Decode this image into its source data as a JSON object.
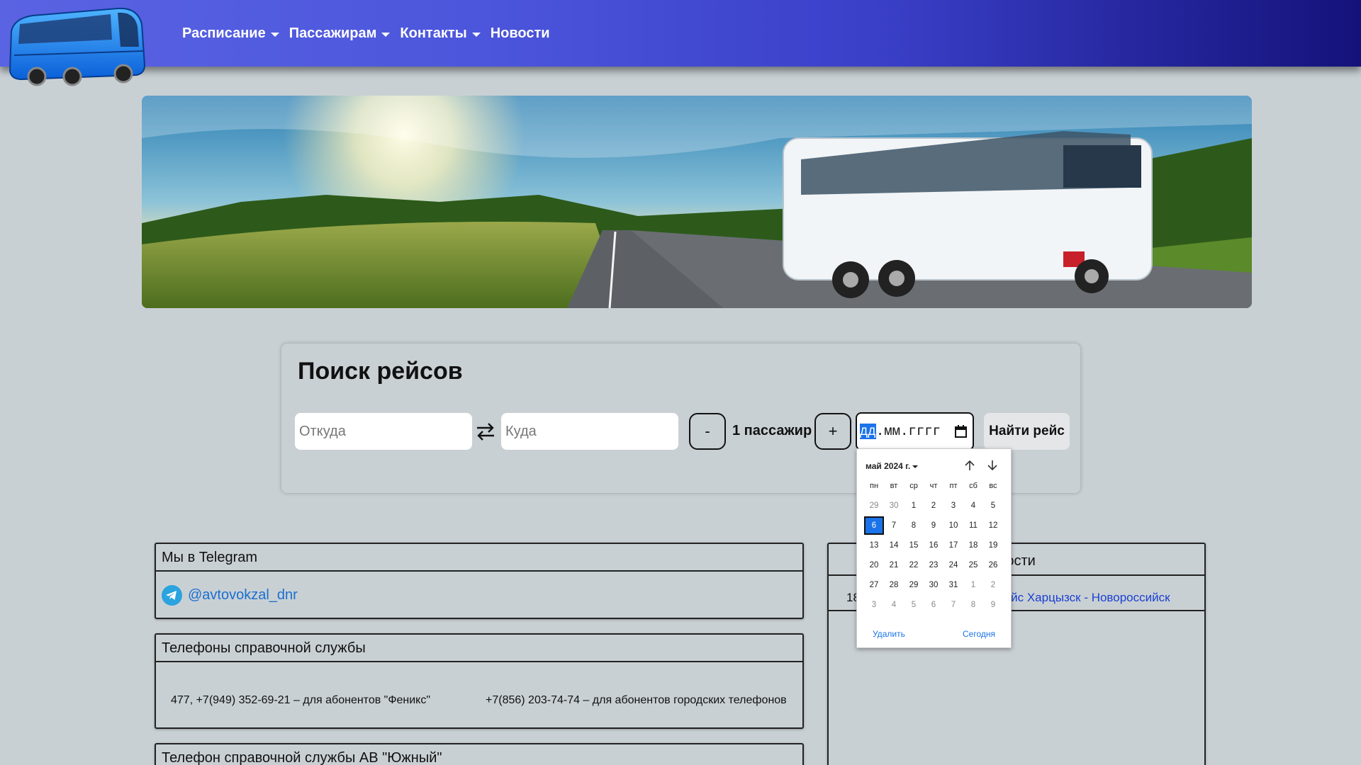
{
  "header": {
    "nav": [
      {
        "label": "Расписание",
        "dropdown": true
      },
      {
        "label": "Пассажирам",
        "dropdown": true
      },
      {
        "label": "Контакты",
        "dropdown": true
      },
      {
        "label": "Новости",
        "dropdown": false
      }
    ],
    "logo_icon": "bus-logo-icon"
  },
  "search": {
    "title": "Поиск рейсов",
    "from_placeholder": "Откуда",
    "to_placeholder": "Куда",
    "minus_label": "-",
    "plus_label": "+",
    "passengers_label": "1 пассажир",
    "date_day": "дд",
    "date_rest": ".мм.гггг",
    "find_label": "Найти рейс"
  },
  "calendar": {
    "month_label": "май 2024 г.",
    "weekdays": [
      "пн",
      "вт",
      "ср",
      "чт",
      "пт",
      "сб",
      "вс"
    ],
    "weeks": [
      [
        "29",
        "30",
        "1",
        "2",
        "3",
        "4",
        "5"
      ],
      [
        "6",
        "7",
        "8",
        "9",
        "10",
        "11",
        "12"
      ],
      [
        "13",
        "14",
        "15",
        "16",
        "17",
        "18",
        "19"
      ],
      [
        "20",
        "21",
        "22",
        "23",
        "24",
        "25",
        "26"
      ],
      [
        "27",
        "28",
        "29",
        "30",
        "31",
        "1",
        "2"
      ],
      [
        "3",
        "4",
        "5",
        "6",
        "7",
        "8",
        "9"
      ]
    ],
    "delete_label": "Удалить",
    "today_label": "Сегодня",
    "selected": "6"
  },
  "telegram": {
    "title": "Мы в Telegram",
    "handle": "@avtovokzal_dnr"
  },
  "phones": {
    "title": "Телефоны справочной службы",
    "phone1": "477, +7(949) 352-69-21 – для абонентов \"Феникс\"",
    "phone2": "+7(856) 203-74-74 – для абонентов городских телефонов"
  },
  "south": {
    "title": "Телефон справочной службы АВ \"Южный\""
  },
  "news": {
    "title": "Новости",
    "title_visible": "вости",
    "item_date": "18",
    "item_text": "й рейс Харцызск - Новороссийск"
  },
  "colors": {
    "header_start": "#5a63e2",
    "header_end": "#14127a",
    "accent": "#1a73e8",
    "background": "#c9d0d4"
  }
}
